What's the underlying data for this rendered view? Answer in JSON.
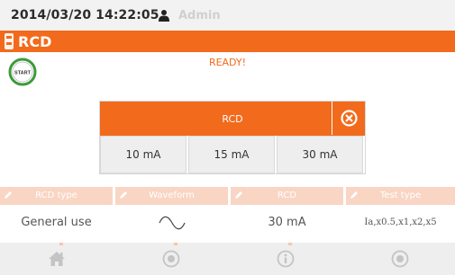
{
  "status": {
    "datetime": "2014/03/20 14:22:05",
    "user_icon": "user-icon",
    "user": "Admin"
  },
  "title": {
    "icon": "rcd-icon",
    "text": "RCD"
  },
  "start_button": {
    "label": "START",
    "icon": "start-icon"
  },
  "status_message": "READY!",
  "dialog": {
    "title": "RCD",
    "close_icon": "close-icon",
    "options": [
      "10 mA",
      "15 mA",
      "30 mA"
    ]
  },
  "params": [
    {
      "label": "RCD type",
      "value": "General use"
    },
    {
      "label": "Waveform",
      "value": "",
      "value_icon": "sine-wave-icon"
    },
    {
      "label": "RCD",
      "value": "30 mA"
    },
    {
      "label": "Test type",
      "value": "Ia,x0.5,x1,x2,x5"
    }
  ],
  "nav": [
    "home-icon",
    "record-icon",
    "info-icon",
    "record-icon"
  ],
  "colors": {
    "accent": "#f26a1b",
    "param_header": "#f9d5c4",
    "start_ring": "#3e9a3a"
  }
}
